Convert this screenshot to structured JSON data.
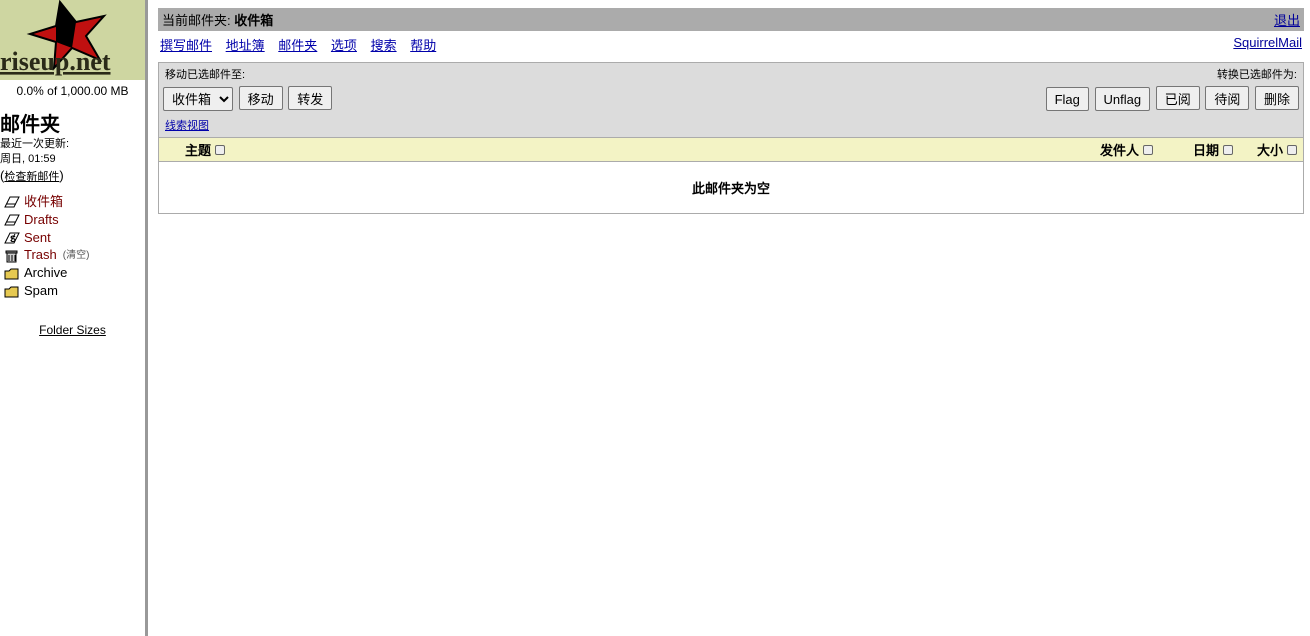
{
  "sidebar": {
    "logo_brand": "riseup.net",
    "quota": "0.0% of 1,000.00 MB",
    "folders_heading": "邮件夹",
    "last_refresh_label": "最近一次更新:",
    "last_refresh_value": "周日, 01:59",
    "check_mail_open": "(",
    "check_mail": "检查新邮件",
    "check_mail_close": ")",
    "folders": {
      "inbox": "收件箱",
      "drafts": "Drafts",
      "sent": "Sent",
      "trash": "Trash",
      "trash_purge": "(清空)",
      "archive": "Archive",
      "spam": "Spam"
    },
    "folder_sizes": "Folder Sizes"
  },
  "titlebar": {
    "prefix": "当前邮件夹: ",
    "folder": "收件箱",
    "signout": "退出"
  },
  "menu": {
    "compose": "撰写邮件",
    "addresses": "地址簿",
    "folders": "邮件夹",
    "options": "选项",
    "search": "搜索",
    "help": "帮助",
    "brand": "SquirrelMail"
  },
  "toolbar": {
    "move_label": "移动已选邮件至:",
    "transform_label": "转换已选邮件为:",
    "move_target": "收件箱",
    "move": "移动",
    "forward": "转发",
    "flag": "Flag",
    "unflag": "Unflag",
    "read": "已阅",
    "unread": "待阅",
    "delete": "删除",
    "thread_view": "线索视图"
  },
  "columns": {
    "subject": "主题",
    "from": "发件人",
    "date": "日期",
    "size": "大小"
  },
  "body": {
    "empty": "此邮件夹为空"
  }
}
